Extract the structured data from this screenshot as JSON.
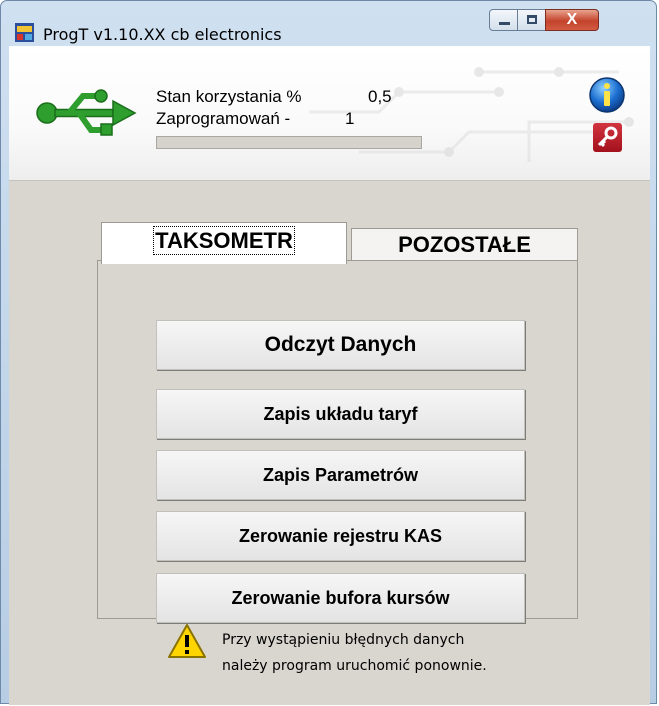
{
  "window": {
    "title": "ProgT v1.10.XX  cb electronics",
    "minimize_icon": "minimize-icon",
    "maximize_icon": "maximize-icon",
    "close_glyph": "X"
  },
  "status": {
    "usage_label": "Stan korzystania %",
    "usage_value": "0,5",
    "programmed_label": "Zaprogramowań  -",
    "programmed_value": "1",
    "progress_fraction": 0
  },
  "icons": {
    "usb": "usb-icon",
    "info": "info-icon",
    "key": "key-icon",
    "warning": "warning-icon"
  },
  "tabs": [
    {
      "label": "TAKSOMETR",
      "active": true
    },
    {
      "label": "POZOSTAŁE",
      "active": false
    }
  ],
  "actions": [
    {
      "label": "Odczyt Danych"
    },
    {
      "label": "Zapis układu taryf"
    },
    {
      "label": "Zapis Parametrów"
    },
    {
      "label": "Zerowanie rejestru KAS"
    },
    {
      "label": "Zerowanie bufora kursów"
    }
  ],
  "warning": {
    "line1": "Przy wystąpieniu błędnych danych",
    "line2": "należy program uruchomić ponownie."
  },
  "colors": {
    "usb_green": "#2e9e2e",
    "info_blue": "#1c6fd1",
    "key_red": "#b51d28",
    "warning_yellow": "#ffd500"
  }
}
